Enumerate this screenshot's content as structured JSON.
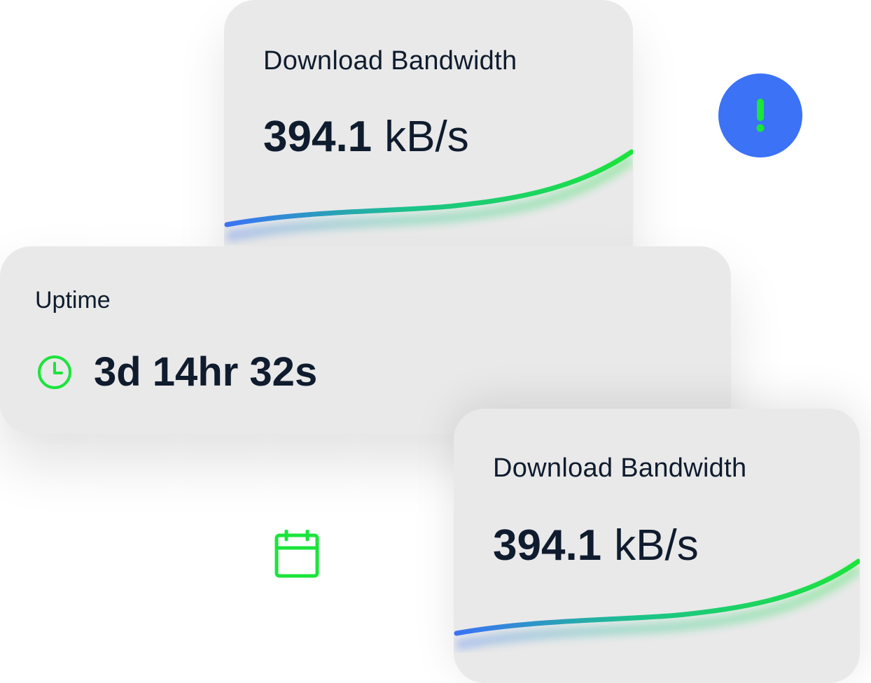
{
  "cards": {
    "bandwidth_top": {
      "title": "Download Bandwidth",
      "value": "394.1",
      "unit": "kB/s"
    },
    "uptime": {
      "title": "Uptime",
      "value": "3d 14hr 32s",
      "icon": "clock-icon"
    },
    "bandwidth_bottom": {
      "title": "Download Bandwidth",
      "value": "394.1",
      "unit": "kB/s"
    }
  },
  "alert": {
    "icon": "exclamation-icon",
    "color": "#3b72f6"
  },
  "calendar": {
    "icon": "calendar-icon"
  },
  "colors": {
    "card_background": "#e9e9e9",
    "text": "#0f1c2e",
    "accent_green": "#1be43b",
    "accent_blue": "#3b72f6"
  }
}
